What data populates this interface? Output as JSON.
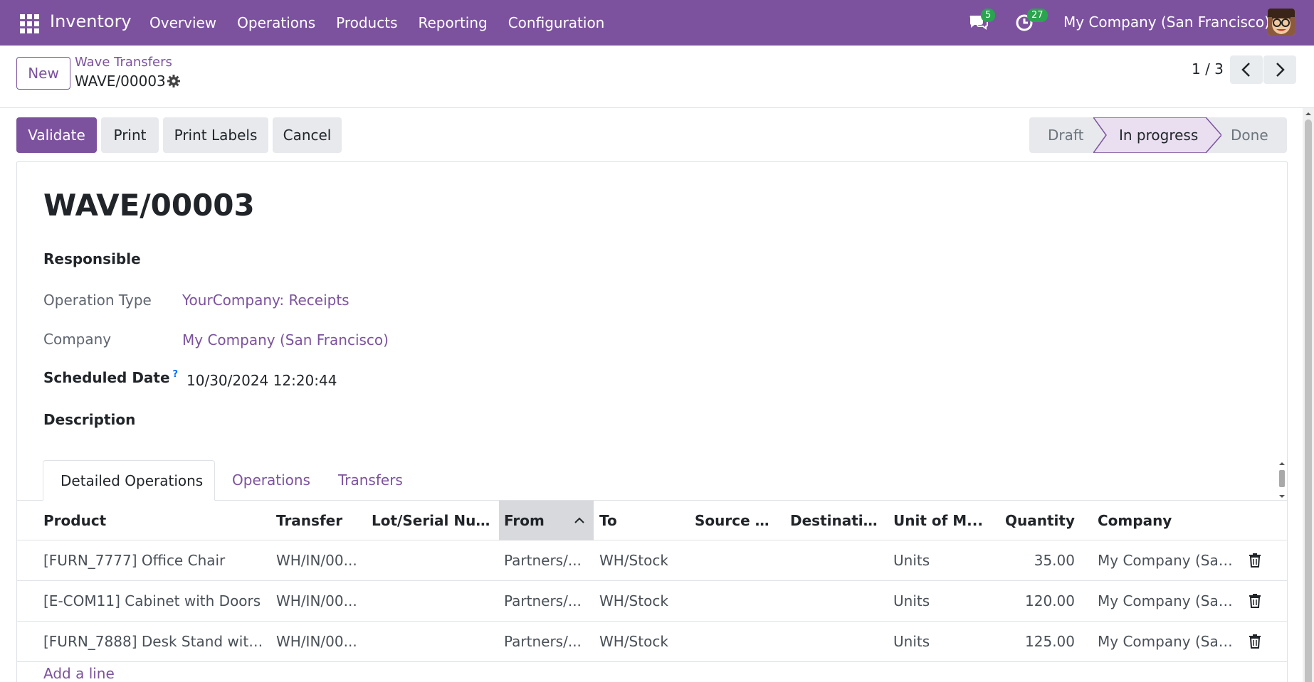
{
  "navbar": {
    "app_name": "Inventory",
    "menu": [
      "Overview",
      "Operations",
      "Products",
      "Reporting",
      "Configuration"
    ],
    "messages_count": "5",
    "activities_count": "27",
    "company": "My Company (San Francisco)"
  },
  "control_panel": {
    "new_label": "New",
    "breadcrumb_parent": "Wave Transfers",
    "breadcrumb_current": "WAVE/00003",
    "pager": "1 / 3"
  },
  "actions": {
    "validate": "Validate",
    "print": "Print",
    "print_labels": "Print Labels",
    "cancel": "Cancel"
  },
  "statusbar": {
    "steps": [
      "Draft",
      "In progress",
      "Done"
    ],
    "active": "In progress"
  },
  "record": {
    "title": "WAVE/00003",
    "responsible_label": "Responsible",
    "operation_type_label": "Operation Type",
    "operation_type_value": "YourCompany: Receipts",
    "company_label": "Company",
    "company_value": "My Company (San Francisco)",
    "scheduled_date_label": "Scheduled Date",
    "scheduled_date_help": "?",
    "scheduled_date_value": "10/30/2024 12:20:44",
    "description_label": "Description"
  },
  "tabs": [
    "Detailed Operations",
    "Operations",
    "Transfers"
  ],
  "table": {
    "columns": [
      "Product",
      "Transfer",
      "Lot/Serial Num...",
      "From",
      "To",
      "Source Pa...",
      "Destinatio...",
      "Unit of M...",
      "Quantity",
      "Company"
    ],
    "rows": [
      {
        "product": "[FURN_7777] Office Chair",
        "transfer": "WH/IN/00...",
        "lot": "",
        "from": "Partners/...",
        "to": "WH/Stock",
        "source_pkg": "",
        "dest_pkg": "",
        "uom": "Units",
        "quantity": "35.00",
        "company": "My Company (San ..."
      },
      {
        "product": "[E-COM11] Cabinet with Doors",
        "transfer": "WH/IN/00...",
        "lot": "",
        "from": "Partners/...",
        "to": "WH/Stock",
        "source_pkg": "",
        "dest_pkg": "",
        "uom": "Units",
        "quantity": "120.00",
        "company": "My Company (San ..."
      },
      {
        "product": "[FURN_7888] Desk Stand with ...",
        "transfer": "WH/IN/00...",
        "lot": "",
        "from": "Partners/...",
        "to": "WH/Stock",
        "source_pkg": "",
        "dest_pkg": "",
        "uom": "Units",
        "quantity": "125.00",
        "company": "My Company (San ..."
      }
    ],
    "add_line": "Add a line"
  },
  "icons": {
    "apps": "apps-grid-icon",
    "messages": "chat-bubbles-icon",
    "activities": "clock-icon",
    "gear": "gear-icon",
    "prev": "chevron-left-icon",
    "next": "chevron-right-icon",
    "sort": "chevron-up-icon",
    "delete": "trash-icon"
  },
  "colors": {
    "brand": "#7c529e",
    "badge": "#2aa44f",
    "active_step": "#e9dff0"
  }
}
